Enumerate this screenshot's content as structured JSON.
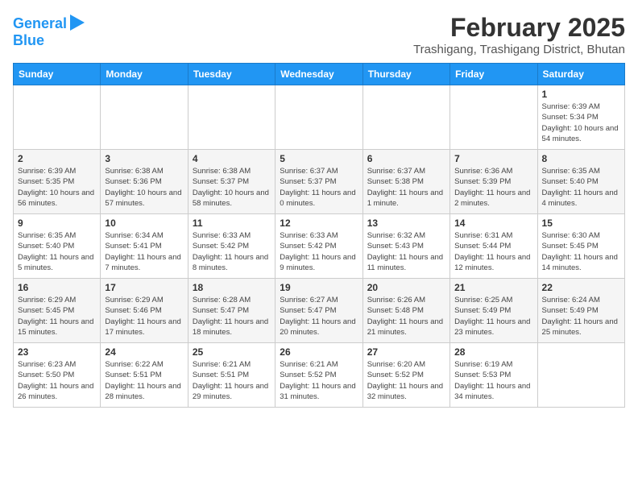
{
  "header": {
    "logo_line1": "General",
    "logo_line2": "Blue",
    "title": "February 2025",
    "subtitle": "Trashigang, Trashigang District, Bhutan"
  },
  "days_of_week": [
    "Sunday",
    "Monday",
    "Tuesday",
    "Wednesday",
    "Thursday",
    "Friday",
    "Saturday"
  ],
  "weeks": [
    [
      {
        "day": "",
        "info": ""
      },
      {
        "day": "",
        "info": ""
      },
      {
        "day": "",
        "info": ""
      },
      {
        "day": "",
        "info": ""
      },
      {
        "day": "",
        "info": ""
      },
      {
        "day": "",
        "info": ""
      },
      {
        "day": "1",
        "info": "Sunrise: 6:39 AM\nSunset: 5:34 PM\nDaylight: 10 hours and 54 minutes."
      }
    ],
    [
      {
        "day": "2",
        "info": "Sunrise: 6:39 AM\nSunset: 5:35 PM\nDaylight: 10 hours and 56 minutes."
      },
      {
        "day": "3",
        "info": "Sunrise: 6:38 AM\nSunset: 5:36 PM\nDaylight: 10 hours and 57 minutes."
      },
      {
        "day": "4",
        "info": "Sunrise: 6:38 AM\nSunset: 5:37 PM\nDaylight: 10 hours and 58 minutes."
      },
      {
        "day": "5",
        "info": "Sunrise: 6:37 AM\nSunset: 5:37 PM\nDaylight: 11 hours and 0 minutes."
      },
      {
        "day": "6",
        "info": "Sunrise: 6:37 AM\nSunset: 5:38 PM\nDaylight: 11 hours and 1 minute."
      },
      {
        "day": "7",
        "info": "Sunrise: 6:36 AM\nSunset: 5:39 PM\nDaylight: 11 hours and 2 minutes."
      },
      {
        "day": "8",
        "info": "Sunrise: 6:35 AM\nSunset: 5:40 PM\nDaylight: 11 hours and 4 minutes."
      }
    ],
    [
      {
        "day": "9",
        "info": "Sunrise: 6:35 AM\nSunset: 5:40 PM\nDaylight: 11 hours and 5 minutes."
      },
      {
        "day": "10",
        "info": "Sunrise: 6:34 AM\nSunset: 5:41 PM\nDaylight: 11 hours and 7 minutes."
      },
      {
        "day": "11",
        "info": "Sunrise: 6:33 AM\nSunset: 5:42 PM\nDaylight: 11 hours and 8 minutes."
      },
      {
        "day": "12",
        "info": "Sunrise: 6:33 AM\nSunset: 5:42 PM\nDaylight: 11 hours and 9 minutes."
      },
      {
        "day": "13",
        "info": "Sunrise: 6:32 AM\nSunset: 5:43 PM\nDaylight: 11 hours and 11 minutes."
      },
      {
        "day": "14",
        "info": "Sunrise: 6:31 AM\nSunset: 5:44 PM\nDaylight: 11 hours and 12 minutes."
      },
      {
        "day": "15",
        "info": "Sunrise: 6:30 AM\nSunset: 5:45 PM\nDaylight: 11 hours and 14 minutes."
      }
    ],
    [
      {
        "day": "16",
        "info": "Sunrise: 6:29 AM\nSunset: 5:45 PM\nDaylight: 11 hours and 15 minutes."
      },
      {
        "day": "17",
        "info": "Sunrise: 6:29 AM\nSunset: 5:46 PM\nDaylight: 11 hours and 17 minutes."
      },
      {
        "day": "18",
        "info": "Sunrise: 6:28 AM\nSunset: 5:47 PM\nDaylight: 11 hours and 18 minutes."
      },
      {
        "day": "19",
        "info": "Sunrise: 6:27 AM\nSunset: 5:47 PM\nDaylight: 11 hours and 20 minutes."
      },
      {
        "day": "20",
        "info": "Sunrise: 6:26 AM\nSunset: 5:48 PM\nDaylight: 11 hours and 21 minutes."
      },
      {
        "day": "21",
        "info": "Sunrise: 6:25 AM\nSunset: 5:49 PM\nDaylight: 11 hours and 23 minutes."
      },
      {
        "day": "22",
        "info": "Sunrise: 6:24 AM\nSunset: 5:49 PM\nDaylight: 11 hours and 25 minutes."
      }
    ],
    [
      {
        "day": "23",
        "info": "Sunrise: 6:23 AM\nSunset: 5:50 PM\nDaylight: 11 hours and 26 minutes."
      },
      {
        "day": "24",
        "info": "Sunrise: 6:22 AM\nSunset: 5:51 PM\nDaylight: 11 hours and 28 minutes."
      },
      {
        "day": "25",
        "info": "Sunrise: 6:21 AM\nSunset: 5:51 PM\nDaylight: 11 hours and 29 minutes."
      },
      {
        "day": "26",
        "info": "Sunrise: 6:21 AM\nSunset: 5:52 PM\nDaylight: 11 hours and 31 minutes."
      },
      {
        "day": "27",
        "info": "Sunrise: 6:20 AM\nSunset: 5:52 PM\nDaylight: 11 hours and 32 minutes."
      },
      {
        "day": "28",
        "info": "Sunrise: 6:19 AM\nSunset: 5:53 PM\nDaylight: 11 hours and 34 minutes."
      },
      {
        "day": "",
        "info": ""
      }
    ]
  ]
}
